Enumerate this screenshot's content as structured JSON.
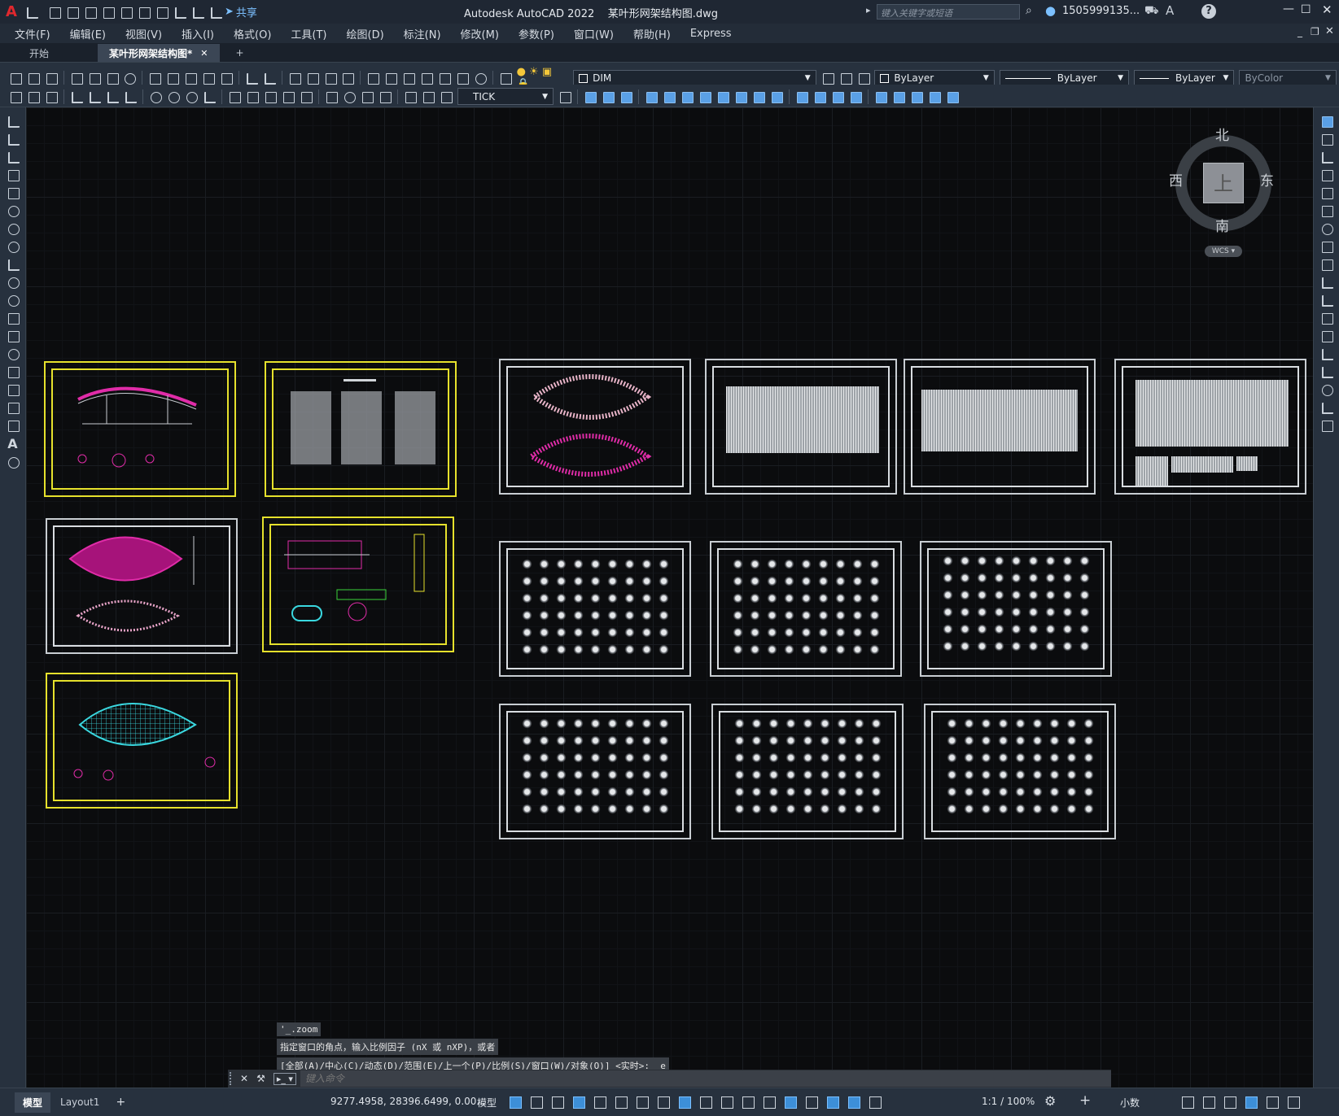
{
  "app": {
    "title": "Autodesk AutoCAD 2022",
    "filename": "某叶形网架结构图.dwg",
    "logo_letter": "A",
    "share_label": "共享",
    "search_placeholder": "键入关键字或短语",
    "user": "1505999135...",
    "help_symbol": "?"
  },
  "menu": [
    "文件(F)",
    "编辑(E)",
    "视图(V)",
    "插入(I)",
    "格式(O)",
    "工具(T)",
    "绘图(D)",
    "标注(N)",
    "修改(M)",
    "参数(P)",
    "窗口(W)",
    "帮助(H)",
    "Express"
  ],
  "tabs": [
    {
      "label": "开始",
      "active": false
    },
    {
      "label": "某叶形网架结构图*",
      "active": true
    }
  ],
  "toolbar": {
    "layer_dropdown": "DIM",
    "dimstyle_dropdown": "TICK",
    "color_dropdown": "ByLayer",
    "linetype_dropdown": "ByLayer",
    "lineweight_dropdown": "ByLayer",
    "plotstyle_dropdown": "ByColor"
  },
  "viewcube": {
    "north": "北",
    "south": "南",
    "east": "东",
    "west": "西",
    "face": "上",
    "wcs": "WCS"
  },
  "command": {
    "history": [
      "'_.zoom",
      "指定窗口的角点，输入比例因子 (nX 或 nXP)，或者",
      "[全部(A)/中心(C)/动态(D)/范围(E)/上一个(P)/比例(S)/窗口(W)/对象(O)] <实时>: _e"
    ],
    "placeholder": "键入命令"
  },
  "layout_tabs": [
    "模型",
    "Layout1"
  ],
  "status": {
    "coords": "9277.4958, 28396.6499, 0.00...",
    "space": "模型",
    "scale": "1:1 / 100%",
    "units": "小数"
  },
  "colors": {
    "accent": "#3d8fd8",
    "yellow_border": "#e6e12c",
    "magenta": "#e02ca8",
    "cyan": "#3ad8e0"
  }
}
